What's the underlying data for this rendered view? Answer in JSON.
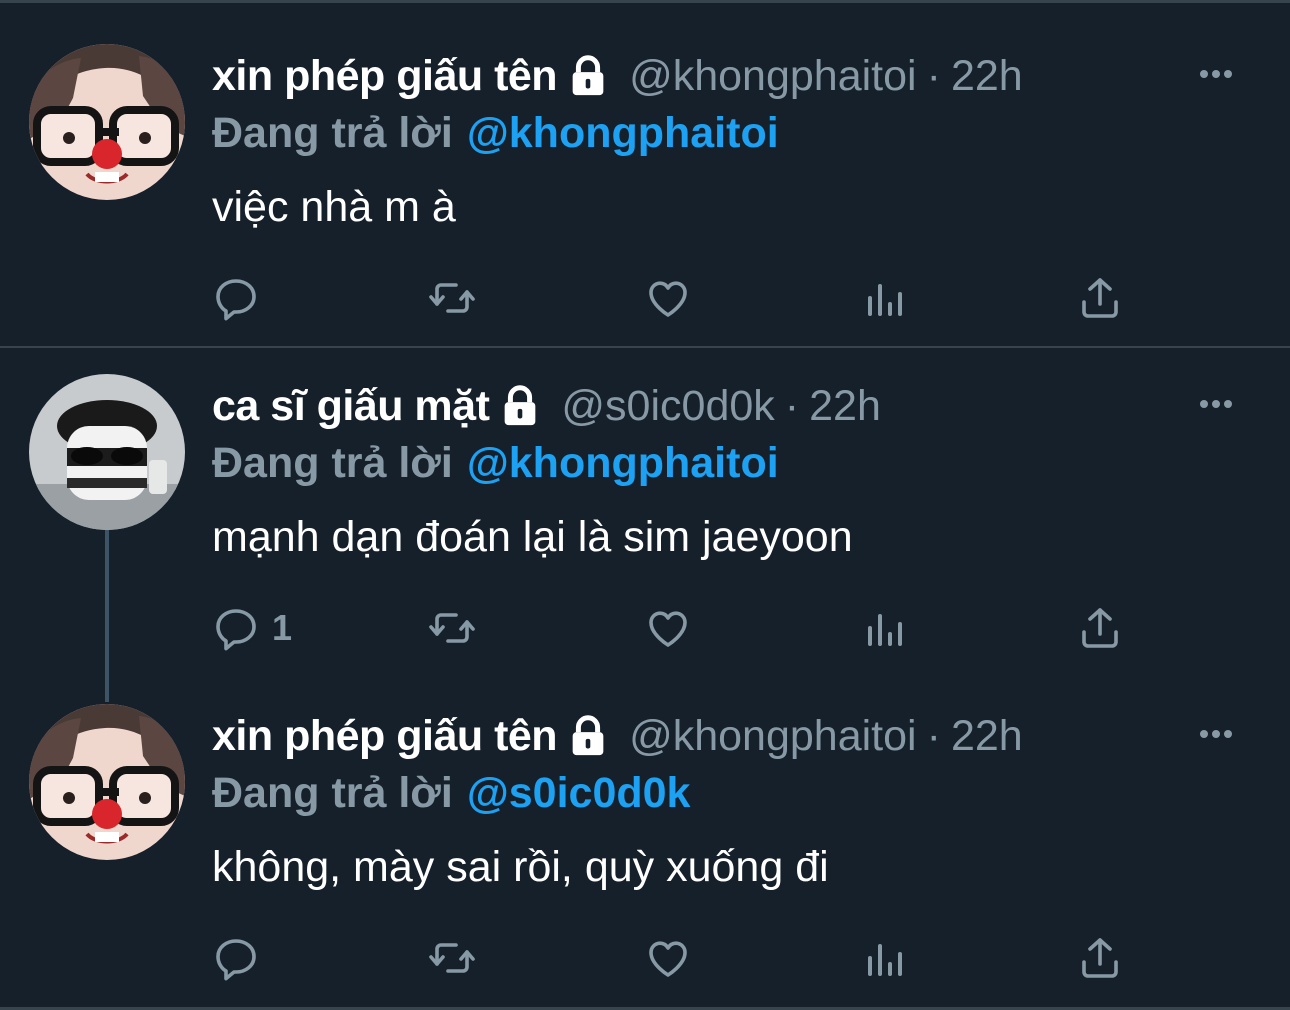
{
  "tweets": [
    {
      "name": "xin phép giấu tên",
      "handle": "@khongphaitoi",
      "dot": "·",
      "time": "22h",
      "reply_label": "Đang trả lời",
      "reply_to": "@khongphaitoi",
      "text": "việc nhà m à",
      "reply_count": "",
      "avatar": "glasses-clown-avatar",
      "icons": [
        "lock-icon",
        "more-icon",
        "reply-icon",
        "retweet-icon",
        "like-icon",
        "analytics-icon",
        "share-icon"
      ]
    },
    {
      "name": "ca sĩ giấu mặt",
      "handle": "@s0ic0d0k",
      "dot": "·",
      "time": "22h",
      "reply_label": "Đang trả lời",
      "reply_to": "@khongphaitoi",
      "text": "mạnh dạn đoán lại là sim jaeyoon",
      "reply_count": "1",
      "avatar": "masked-figure-avatar",
      "icons": [
        "lock-icon",
        "more-icon",
        "reply-icon",
        "retweet-icon",
        "like-icon",
        "analytics-icon",
        "share-icon"
      ]
    },
    {
      "name": "xin phép giấu tên",
      "handle": "@khongphaitoi",
      "dot": "·",
      "time": "22h",
      "reply_label": "Đang trả lời",
      "reply_to": "@s0ic0d0k",
      "text": "không, mày sai rồi, quỳ xuống đi",
      "reply_count": "",
      "avatar": "glasses-clown-avatar",
      "icons": [
        "lock-icon",
        "more-icon",
        "reply-icon",
        "retweet-icon",
        "like-icon",
        "analytics-icon",
        "share-icon"
      ]
    }
  ],
  "colors": {
    "background": "#15202b",
    "secondary_text": "#8899a6",
    "accent": "#1da1f2",
    "divider": "#38444d"
  }
}
